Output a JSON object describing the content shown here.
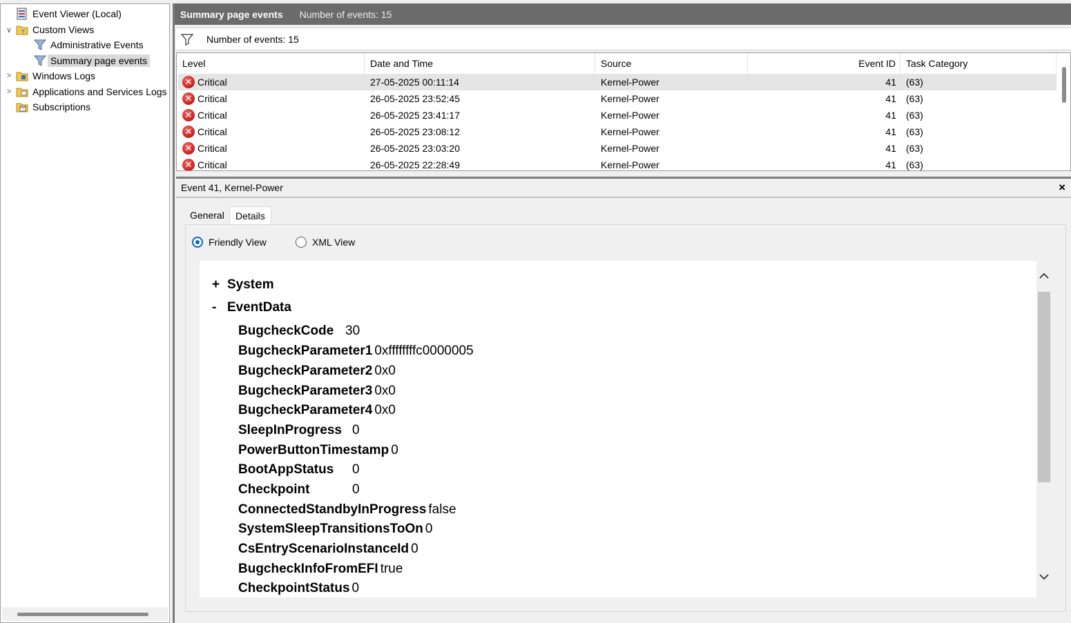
{
  "tree": {
    "items": [
      {
        "label": "Event Viewer (Local)",
        "expander": "",
        "icon": "event-viewer-icon"
      },
      {
        "label": "Custom Views",
        "expander": "∨",
        "icon": "folder-icon"
      },
      {
        "label": "Administrative Events",
        "expander": "",
        "icon": "filter-icon"
      },
      {
        "label": "Summary page events",
        "expander": "",
        "icon": "filter-icon",
        "selected": true
      },
      {
        "label": "Windows Logs",
        "expander": ">",
        "icon": "folder-icon"
      },
      {
        "label": "Applications and Services Logs",
        "expander": ">",
        "icon": "folder-icon"
      },
      {
        "label": "Subscriptions",
        "expander": "",
        "icon": "subscriptions-icon"
      }
    ]
  },
  "header": {
    "title": "Summary page events",
    "count": "Number of events: 15"
  },
  "filter": {
    "text": "Number of events: 15"
  },
  "table": {
    "columns": [
      "Level",
      "Date and Time",
      "Source",
      "Event ID",
      "Task Category"
    ],
    "rows": [
      {
        "level": "Critical",
        "date": "27-05-2025 00:11:14",
        "source": "Kernel-Power",
        "event_id": "41",
        "task": "(63)"
      },
      {
        "level": "Critical",
        "date": "26-05-2025 23:52:45",
        "source": "Kernel-Power",
        "event_id": "41",
        "task": "(63)"
      },
      {
        "level": "Critical",
        "date": "26-05-2025 23:41:17",
        "source": "Kernel-Power",
        "event_id": "41",
        "task": "(63)"
      },
      {
        "level": "Critical",
        "date": "26-05-2025 23:08:12",
        "source": "Kernel-Power",
        "event_id": "41",
        "task": "(63)"
      },
      {
        "level": "Critical",
        "date": "26-05-2025 23:03:20",
        "source": "Kernel-Power",
        "event_id": "41",
        "task": "(63)"
      },
      {
        "level": "Critical",
        "date": "26-05-2025 22:28:49",
        "source": "Kernel-Power",
        "event_id": "41",
        "task": "(63)"
      }
    ]
  },
  "detail": {
    "title": "Event 41, Kernel-Power",
    "close": "×",
    "tabs": [
      "General",
      "Details"
    ],
    "active_tab": "Details",
    "view_options": [
      "Friendly View",
      "XML View"
    ],
    "selected_view": "Friendly View",
    "system": {
      "symbol": "+",
      "label": "System"
    },
    "eventdata": {
      "symbol": "-",
      "label": "EventData"
    },
    "fields": [
      {
        "key": "BugcheckCode",
        "value": "30"
      },
      {
        "key": "BugcheckParameter1",
        "value": "0xffffffffc0000005"
      },
      {
        "key": "BugcheckParameter2",
        "value": "0x0"
      },
      {
        "key": "BugcheckParameter3",
        "value": "0x0"
      },
      {
        "key": "BugcheckParameter4",
        "value": "0x0"
      },
      {
        "key": "SleepInProgress",
        "value": "0"
      },
      {
        "key": "PowerButtonTimestamp",
        "value": "0"
      },
      {
        "key": "BootAppStatus",
        "value": "0"
      },
      {
        "key": "Checkpoint",
        "value": "0"
      },
      {
        "key": "ConnectedStandbyInProgress",
        "value": "false"
      },
      {
        "key": "SystemSleepTransitionsToOn",
        "value": "0"
      },
      {
        "key": "CsEntryScenarioInstanceId",
        "value": "0"
      },
      {
        "key": "BugcheckInfoFromEFI",
        "value": "true"
      },
      {
        "key": "CheckpointStatus",
        "value": "0"
      }
    ]
  },
  "colors": {
    "header_bg": "#6b6b6b",
    "critical": "#c41e1e",
    "radio_accent": "#0067c0",
    "selection": "#d9d9d9"
  }
}
